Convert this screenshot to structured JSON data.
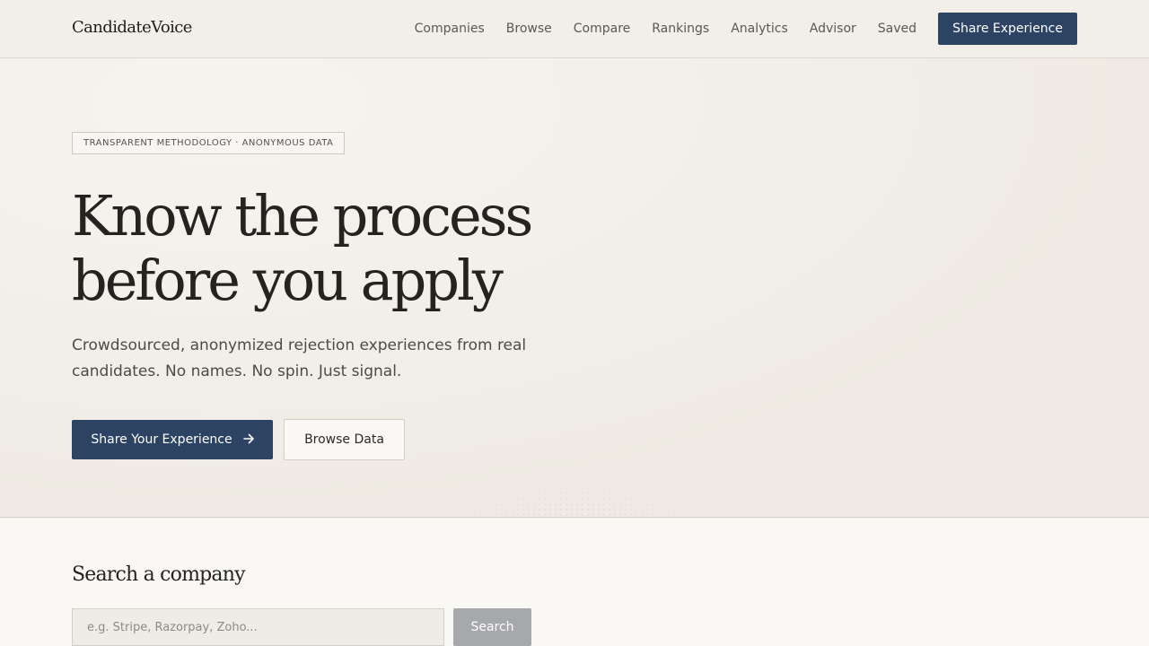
{
  "brand": {
    "name": "CandidateVoice"
  },
  "nav": {
    "links": [
      "Companies",
      "Browse",
      "Compare",
      "Rankings",
      "Analytics",
      "Advisor",
      "Saved"
    ],
    "cta_label": "Share Experience"
  },
  "hero": {
    "eyebrow": "TRANSPARENT METHODOLOGY · ANONYMOUS DATA",
    "headline_line1": "Know the process",
    "headline_line2": "before you apply",
    "subhead_line1": "Crowdsourced, anonymized rejection experiences from real",
    "subhead_line2": "candidates. No names. No spin. Just signal.",
    "primary_cta": "Share Your Experience",
    "primary_cta_icon": "arrow-right-icon",
    "secondary_cta": "Browse Data"
  },
  "search": {
    "title": "Search a company",
    "placeholder": "e.g. Stripe, Razorpay, Zoho...",
    "value": "",
    "button_label": "Search"
  },
  "colors": {
    "background": "#f2efe9",
    "primary": "#2c4363",
    "disabled_button": "#a6a8ab"
  }
}
